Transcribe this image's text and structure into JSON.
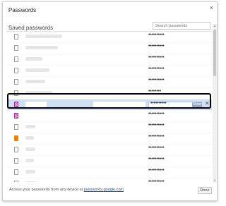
{
  "dialog": {
    "title": "Passwords",
    "close_glyph": "×",
    "section_title": "Saved passwords",
    "search_placeholder": "Search passwords"
  },
  "rows": [
    {
      "favicon": "page-icon",
      "password": "••••••••••"
    },
    {
      "favicon": "page-icon",
      "password": "••••••••••"
    },
    {
      "favicon": "page-icon",
      "password": "••••••••••"
    },
    {
      "favicon": "page-icon",
      "password": "••••••••••"
    },
    {
      "favicon": "page-icon",
      "password": "••••••••••"
    },
    {
      "favicon": "page-icon",
      "password": "••••••••"
    }
  ],
  "selected_row": {
    "favicon": "hb-icon",
    "password": "••••••••••",
    "show_label": "Show",
    "remove_glyph": "✕"
  },
  "rows_after": [
    {
      "favicon": "hb-icon",
      "password": "••••••••••"
    },
    {
      "favicon": "page-icon",
      "password": "••••••••••"
    },
    {
      "favicon": "blogger-icon",
      "password": "••••••••••"
    },
    {
      "favicon": "page-icon",
      "password": "••••••••••"
    },
    {
      "favicon": "page-icon",
      "password": "••••••••••"
    },
    {
      "favicon": "page-icon",
      "password": "••••••••••"
    },
    {
      "favicon": "page-icon",
      "password": "••••••••••"
    },
    {
      "favicon": "page-icon",
      "password": "••••••••••"
    }
  ],
  "footer": {
    "text": "Access your passwords from any device at ",
    "link": "passwords.google.com",
    "done_label": "Done"
  },
  "colors": {
    "selected_row_bg": "#cfe0f5",
    "highlight_border": "#000000",
    "link": "#1155cc"
  }
}
